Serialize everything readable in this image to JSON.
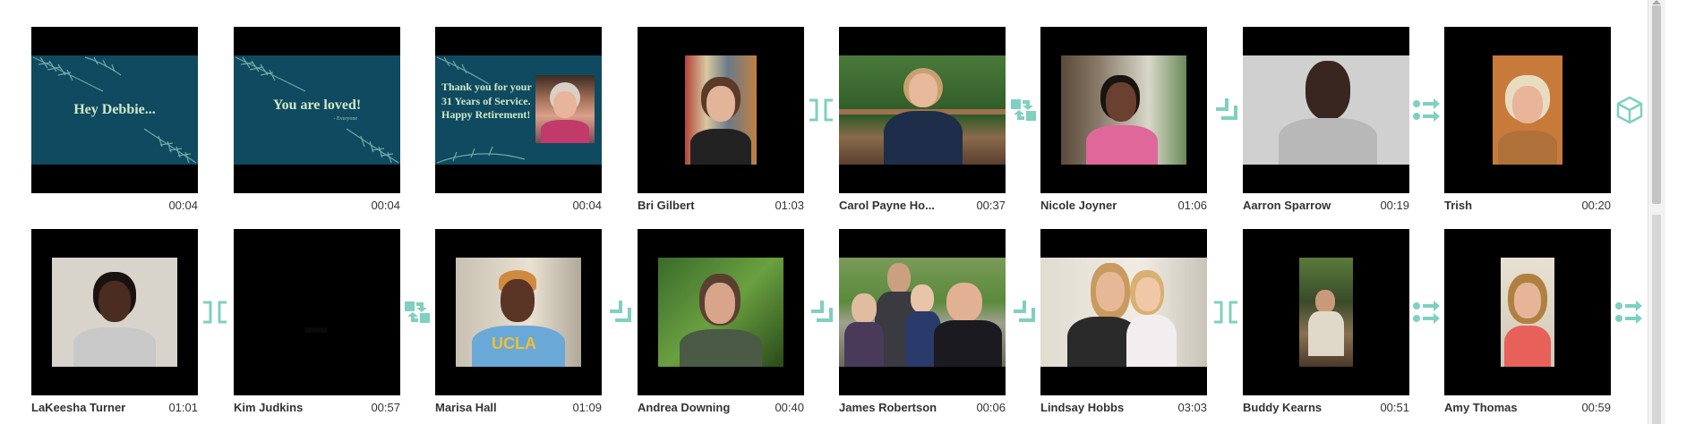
{
  "colors": {
    "transition_accent": "#7fd0c0",
    "slide_bg": "#0f4a60",
    "tile_bg": "#000000"
  },
  "row1": [
    {
      "name": "",
      "duration": "00:04",
      "kind": "slide",
      "slide": {
        "title": "Hey Debbie..."
      }
    },
    {
      "name": "",
      "duration": "00:04",
      "kind": "slide",
      "slide": {
        "title": "You are loved!",
        "subtitle": "- Everyone"
      }
    },
    {
      "name": "",
      "duration": "00:04",
      "kind": "slide",
      "slide": {
        "line1": "Thank you for your",
        "line2": "31 Years of Service.",
        "line3": "Happy Retirement!"
      }
    },
    {
      "name": "Bri Gilbert",
      "duration": "01:03",
      "kind": "video"
    },
    {
      "name": "Carol Payne Ho...",
      "duration": "00:37",
      "kind": "video"
    },
    {
      "name": "Nicole Joyner",
      "duration": "01:06",
      "kind": "video"
    },
    {
      "name": "Aarron Sparrow",
      "duration": "00:19",
      "kind": "video"
    },
    {
      "name": "Trish",
      "duration": "00:20",
      "kind": "video"
    }
  ],
  "row2": [
    {
      "name": "LaKeesha Turner",
      "duration": "01:01",
      "kind": "video"
    },
    {
      "name": "Kim Judkins",
      "duration": "00:57",
      "kind": "video"
    },
    {
      "name": "Marisa Hall",
      "duration": "01:09",
      "kind": "video"
    },
    {
      "name": "Andrea Downing",
      "duration": "00:40",
      "kind": "video"
    },
    {
      "name": "James Robertson",
      "duration": "00:06",
      "kind": "video"
    },
    {
      "name": "Lindsay Hobbs",
      "duration": "03:03",
      "kind": "video"
    },
    {
      "name": "Buddy Kearns",
      "duration": "00:51",
      "kind": "video"
    },
    {
      "name": "Amy Thomas",
      "duration": "00:59",
      "kind": "video"
    }
  ],
  "transitions_row1": [
    "bracket-icon",
    "swap-icon",
    "corner-icon",
    "dots-arrow-icon",
    "cube-icon"
  ],
  "transitions_row2": [
    "bracket-icon",
    "swap-icon",
    "corner-icon",
    "corner-icon",
    "corner-icon",
    "bracket-icon",
    "dots-arrow-icon",
    "dots-arrow-icon"
  ]
}
